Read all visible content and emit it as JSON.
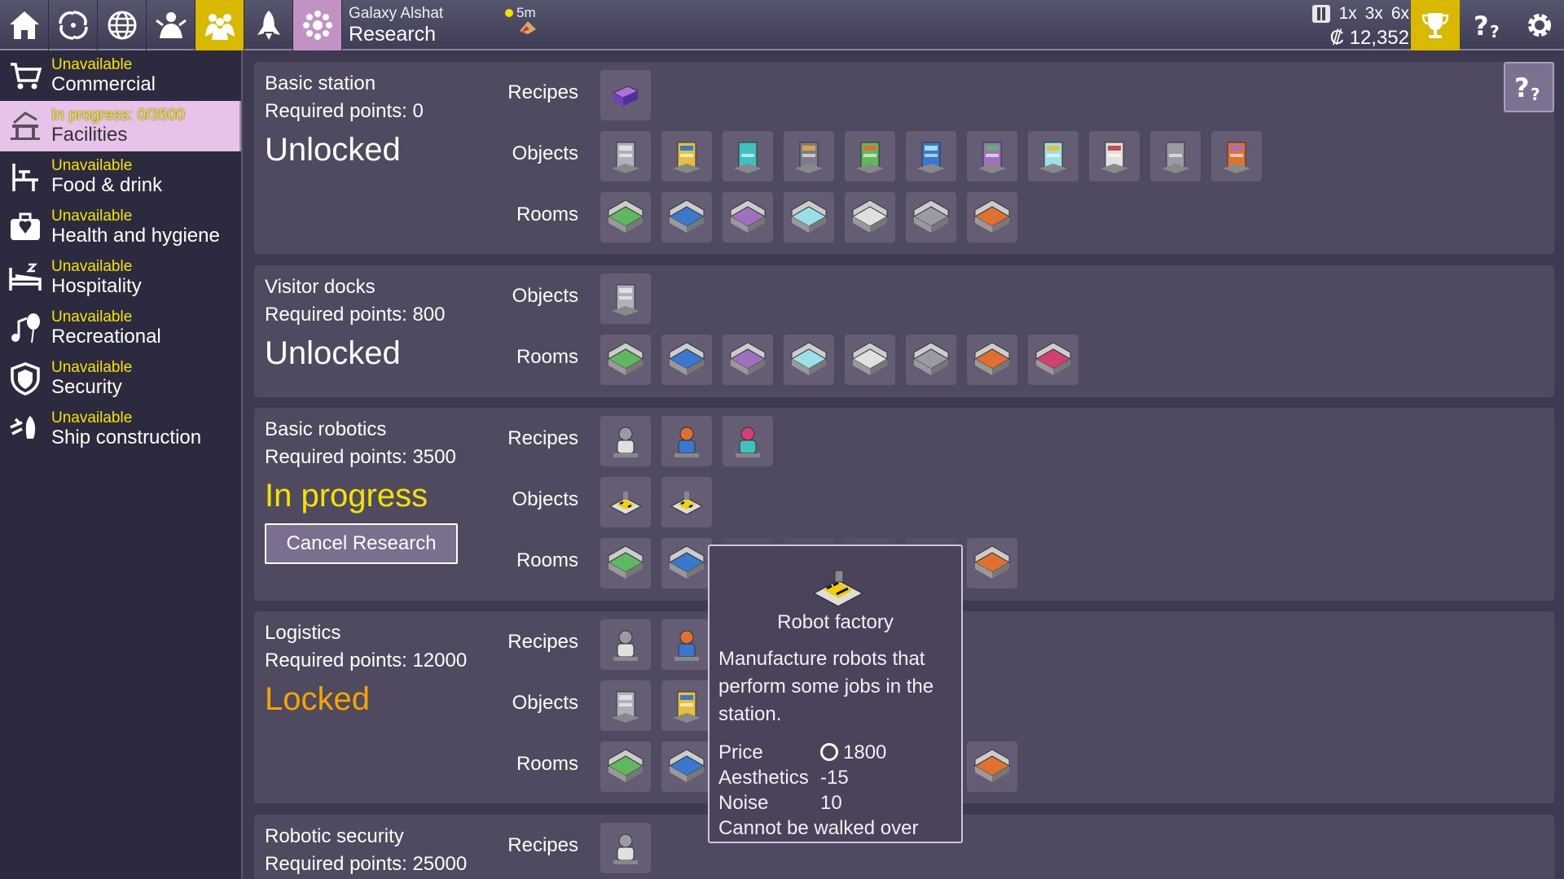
{
  "topbar": {
    "tabs": [
      {
        "icon": "home-icon",
        "active": false
      },
      {
        "icon": "galaxy-icon",
        "active": false
      },
      {
        "icon": "globe-icon",
        "active": false
      },
      {
        "icon": "people-icon",
        "active": false
      },
      {
        "icon": "crew-icon",
        "active": true
      },
      {
        "icon": "rocket-icon",
        "active": false
      },
      {
        "icon": "research-icon",
        "active": true
      }
    ],
    "system_name": "Galaxy Alshat",
    "screen_title": "Research",
    "timer": "5m",
    "speeds": [
      "1x",
      "3x",
      "6x"
    ],
    "money": "12,352"
  },
  "sidebar": {
    "categories": [
      {
        "status": "Unavailable",
        "name": "Commercial",
        "icon": "cart-icon"
      },
      {
        "status": "In progress: 0/3500",
        "name": "Facilities",
        "icon": "facilities-icon",
        "selected": true
      },
      {
        "status": "Unavailable",
        "name": "Food & drink",
        "icon": "dining-icon"
      },
      {
        "status": "Unavailable",
        "name": "Health and hygiene",
        "icon": "medkit-icon"
      },
      {
        "status": "Unavailable",
        "name": "Hospitality",
        "icon": "bed-icon"
      },
      {
        "status": "Unavailable",
        "name": "Recreational",
        "icon": "music-icon"
      },
      {
        "status": "Unavailable",
        "name": "Security",
        "icon": "shield-icon"
      },
      {
        "status": "Unavailable",
        "name": "Ship construction",
        "icon": "ship-icon"
      }
    ]
  },
  "research": [
    {
      "title": "Basic station",
      "required": "Required points: 0",
      "status": "Unlocked",
      "rows": [
        {
          "label": "Recipes",
          "count": 1
        },
        {
          "label": "Objects",
          "count": 11
        },
        {
          "label": "Rooms",
          "count": 7
        }
      ]
    },
    {
      "title": "Visitor docks",
      "required": "Required points: 800",
      "status": "Unlocked",
      "rows": [
        {
          "label": "Objects",
          "count": 1
        },
        {
          "label": "Rooms",
          "count": 8
        }
      ]
    },
    {
      "title": "Basic robotics",
      "required": "Required points: 3500",
      "status": "In progress",
      "cancel_label": "Cancel Research",
      "rows": [
        {
          "label": "Recipes",
          "count": 3
        },
        {
          "label": "Objects",
          "count": 2
        },
        {
          "label": "Rooms",
          "count": 7
        }
      ]
    },
    {
      "title": "Logistics",
      "required": "Required points: 12000",
      "status": "Locked",
      "rows": [
        {
          "label": "Recipes",
          "count": 2
        },
        {
          "label": "Objects",
          "count": 2
        },
        {
          "label": "Rooms",
          "count": 7
        }
      ]
    },
    {
      "title": "Robotic security",
      "required": "Required points: 25000",
      "status": "",
      "rows": [
        {
          "label": "Recipes",
          "count": 1
        }
      ]
    }
  ],
  "tooltip": {
    "name": "Robot factory",
    "description": "Manufacture robots that perform some jobs in the station.",
    "price_label": "Price",
    "price": "1800",
    "aesthetics_label": "Aesthetics",
    "aesthetics": "-15",
    "noise_label": "Noise",
    "noise": "10",
    "note": "Cannot be walked over"
  },
  "colors": {
    "accent": "#d9b800",
    "selected": "#e7c3ea",
    "in_progress": "#f3e400",
    "locked": "#f4a500",
    "unavailable": "#f5e300"
  }
}
